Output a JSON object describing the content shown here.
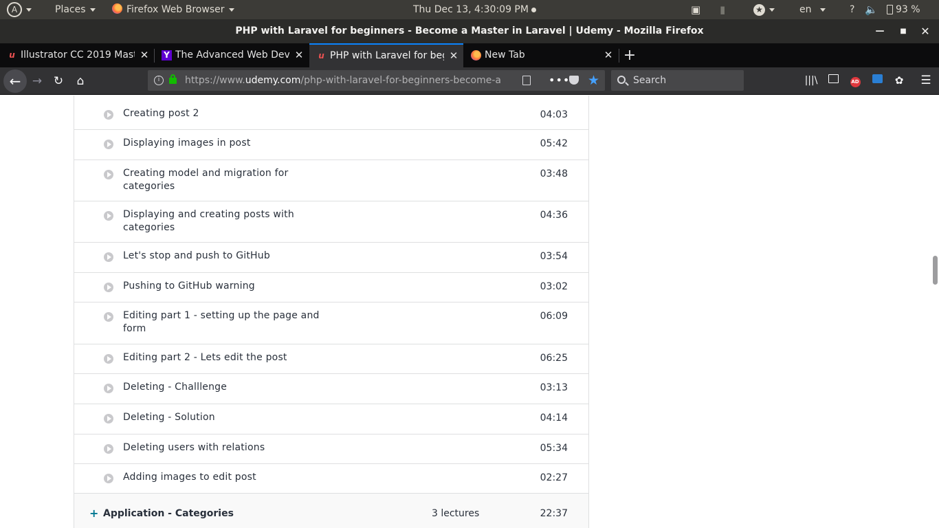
{
  "top_panel": {
    "places": "Places",
    "app_name": "Firefox Web Browser",
    "clock": "Thu Dec 13,  4:30:09 PM",
    "language": "en",
    "help": "?",
    "battery": "93 %"
  },
  "window": {
    "title": "PHP with Laravel for beginners - Become a Master in Laravel | Udemy - Mozilla Firefox"
  },
  "tabs": [
    {
      "label": "Illustrator CC 2019 Maste",
      "favicon": "udemy-icon",
      "active": false
    },
    {
      "label": "The Advanced Web Deve",
      "favicon": "yahoo-icon",
      "active": false
    },
    {
      "label": "PHP with Laravel for beg",
      "favicon": "udemy-icon",
      "active": true
    },
    {
      "label": "New Tab",
      "favicon": "firefox-icon",
      "active": false
    }
  ],
  "toolbar": {
    "url_prefix": "https://www.",
    "url_domain": "udemy.com",
    "url_path": "/php-with-laravel-for-beginners-become-a-",
    "search_placeholder": "Search"
  },
  "lectures": [
    {
      "title": "Creating post 2",
      "duration": "04:03"
    },
    {
      "title": "Displaying images in post",
      "duration": "05:42"
    },
    {
      "title": "Creating model and migration for categories",
      "duration": "03:48"
    },
    {
      "title": "Displaying and creating posts with categories",
      "duration": "04:36"
    },
    {
      "title": "Let's stop and push to GitHub",
      "duration": "03:54"
    },
    {
      "title": "Pushing to GitHub warning",
      "duration": "03:02"
    },
    {
      "title": "Editing part 1 - setting up the page and form",
      "duration": "06:09"
    },
    {
      "title": "Editing part 2 - Lets edit the post",
      "duration": "06:25"
    },
    {
      "title": "Deleting - Challlenge",
      "duration": "03:13"
    },
    {
      "title": "Deleting - Solution",
      "duration": "04:14"
    },
    {
      "title": "Deleting users with relations",
      "duration": "05:34"
    },
    {
      "title": "Adding images to edit post",
      "duration": "02:27"
    }
  ],
  "next_section": {
    "plus": "+",
    "name": "Application - Categories",
    "lecture_count": "3 lectures",
    "total_duration": "22:37"
  },
  "colors": {
    "accent": "#0a84ff",
    "udemy_link": "#007791",
    "text": "#29303b"
  }
}
